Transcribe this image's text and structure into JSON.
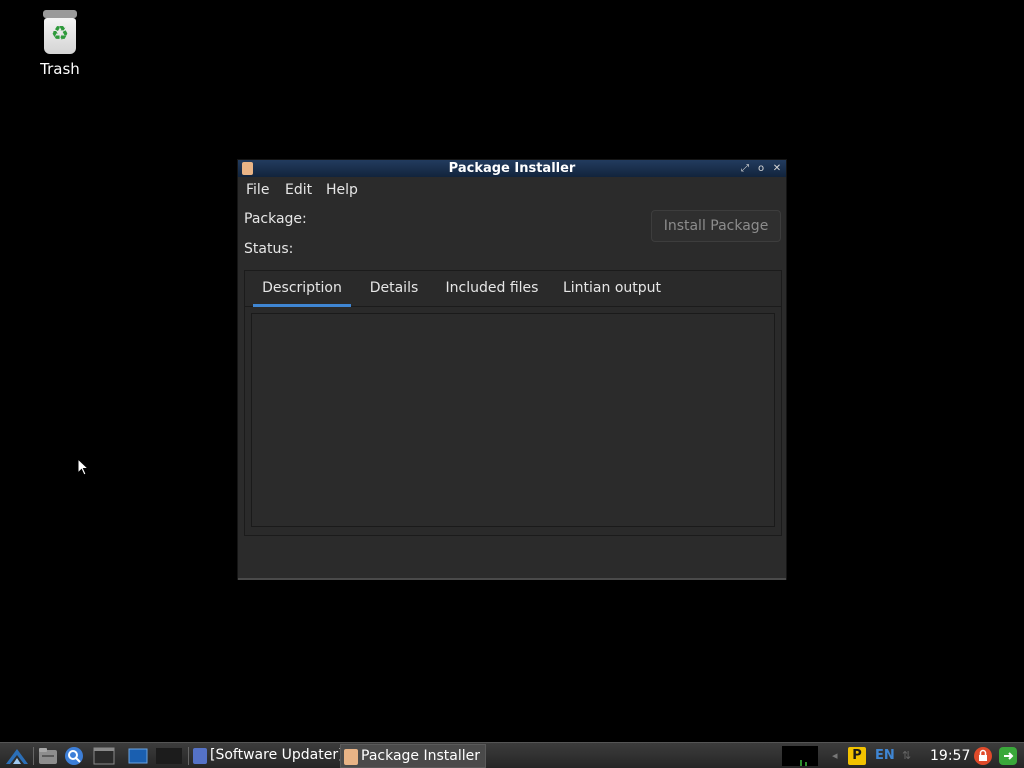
{
  "desktop": {
    "trash_label": "Trash"
  },
  "window": {
    "title": "Package Installer",
    "menu": [
      "File",
      "Edit",
      "Help"
    ],
    "package_label": "Package:",
    "status_label": "Status:",
    "install_button": "Install Package",
    "tabs": [
      "Description",
      "Details",
      "Included files",
      "Lintian output"
    ],
    "active_tab": "Description",
    "accent_color": "#3f86d3"
  },
  "taskbar": {
    "tasks": [
      "[Software Updater]",
      "Package Installer"
    ],
    "active_task": "Package Installer",
    "language": "EN",
    "clock": "19:57",
    "tray_badge": "P"
  }
}
